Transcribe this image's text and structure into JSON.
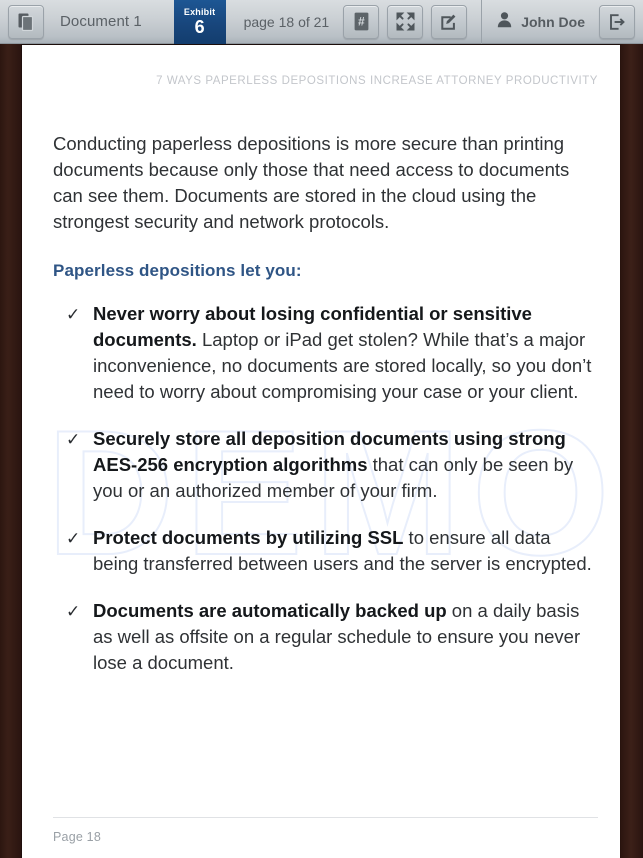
{
  "toolbar": {
    "doc_icon": "documents-icon",
    "document_title": "Document 1",
    "exhibit": {
      "label": "Exhibit",
      "number": "6"
    },
    "page_indicator": "page 18 of 21",
    "buttons": [
      {
        "name": "page-number-button",
        "icon": "hash-icon"
      },
      {
        "name": "fullscreen-button",
        "icon": "expand-arrows-icon"
      },
      {
        "name": "annotate-button",
        "icon": "pencil-square-icon"
      }
    ],
    "user": {
      "icon": "person-icon",
      "name": "John Doe"
    },
    "logout": {
      "icon": "logout-icon"
    }
  },
  "document": {
    "running_header": "7 WAYS PAPERLESS DEPOSITIONS INCREASE ATTORNEY PRODUCTIVITY",
    "watermark": "DEMO",
    "intro_paragraph": "Conducting paperless depositions is more secure than printing documents because only those that need access to documents can see them. Documents are stored in the cloud using the strongest security and network protocols.",
    "subheading": "Paperless depositions let you:",
    "bullet_mark": "✓",
    "bullets": [
      {
        "bold": "Never worry about losing confidential or sensitive documents.",
        "rest": " Laptop or iPad get stolen? While that’s a major inconvenience, no documents are stored locally, so you don’t need to worry about compromising your case or your client."
      },
      {
        "bold": "Securely store all deposition documents using strong AES-256 encryption algorithms",
        "rest": " that can only be seen by you or an authorized member of your firm."
      },
      {
        "bold": "Protect documents by utilizing SSL",
        "rest": " to ensure all data being transferred between users and the server is encrypted."
      },
      {
        "bold": "Documents are automatically backed up",
        "rest": " on a daily basis as well as offsite on a regular schedule to ensure you never lose a document."
      }
    ],
    "footer_page": "Page 18"
  },
  "colors": {
    "toolbar_top": "#d9dde0",
    "toolbar_bottom": "#aab2b9",
    "exhibit_blue": "#18467c",
    "subheading_blue": "#2f5585",
    "body_text": "#2f3235",
    "header_gray": "#c3c6cb",
    "footer_gray": "#9aa0a6",
    "page_background": "#ffffff",
    "app_background": "#2a1410",
    "watermark_blue": "#e8eefb"
  }
}
